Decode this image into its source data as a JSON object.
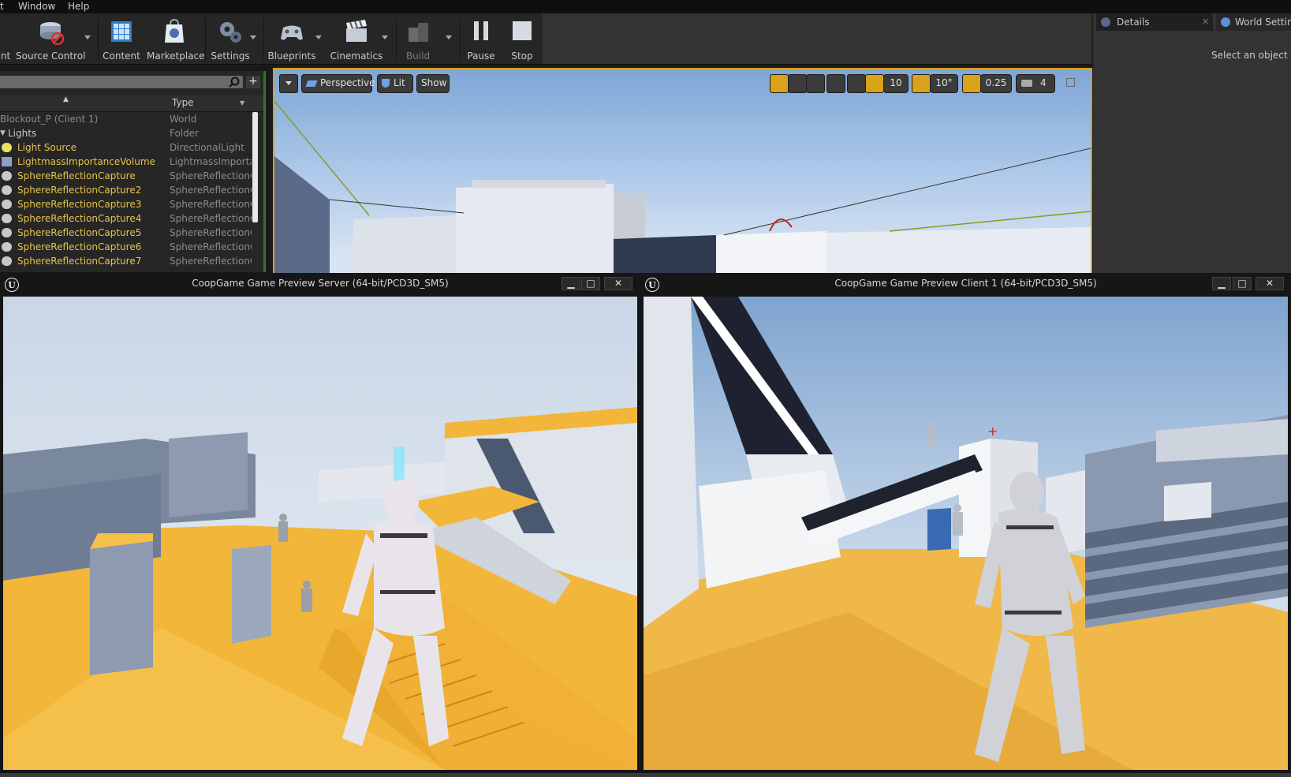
{
  "menu": [
    "t",
    "Window",
    "Help"
  ],
  "toolbar": {
    "source_control": "Source Control",
    "content": "Content",
    "marketplace": "Marketplace",
    "settings": "Settings",
    "blueprints": "Blueprints",
    "cinematics": "Cinematics",
    "build": "Build",
    "pause": "Pause",
    "stop": "Stop",
    "left_cut": "nt"
  },
  "details": {
    "tab_details": "Details",
    "tab_world": "World Setting",
    "hint": "Select an object to"
  },
  "outliner": {
    "header_type": "Type",
    "rows": [
      {
        "name": "Blockout_P (Client 1)",
        "type": "World"
      },
      {
        "name": "Lights",
        "type": "Folder"
      },
      {
        "name": "Light Source",
        "type": "DirectionalLight"
      },
      {
        "name": "LightmassImportanceVolume",
        "type": "LightmassImportar"
      },
      {
        "name": "SphereReflectionCapture",
        "type": "SphereReflectionCa"
      },
      {
        "name": "SphereReflectionCapture2",
        "type": "SphereReflectionCa"
      },
      {
        "name": "SphereReflectionCapture3",
        "type": "SphereReflectionCa"
      },
      {
        "name": "SphereReflectionCapture4",
        "type": "SphereReflectionCa"
      },
      {
        "name": "SphereReflectionCapture5",
        "type": "SphereReflectionCa"
      },
      {
        "name": "SphereReflectionCapture6",
        "type": "SphereReflectionCa"
      },
      {
        "name": "SphereReflectionCapture7",
        "type": "SphereReflectionCa"
      }
    ]
  },
  "viewport": {
    "perspective": "Perspective",
    "lit": "Lit",
    "show": "Show",
    "grid_snap": "10",
    "rot_snap": "10°",
    "scale_snap": "0.25",
    "cam_speed": "4"
  },
  "server_window": {
    "title": "CoopGame Game Preview Server (64-bit/PCD3D_SM5)"
  },
  "client_window": {
    "title": "CoopGame Game Preview Client 1 (64-bit/PCD3D_SM5)"
  },
  "window_controls": {
    "minimize": "▁",
    "maximize": "□",
    "close": "✕"
  },
  "colors": {
    "accent": "#d9a21b",
    "actor_name": "#e6c34c",
    "select_green": "#2a7a2a"
  }
}
